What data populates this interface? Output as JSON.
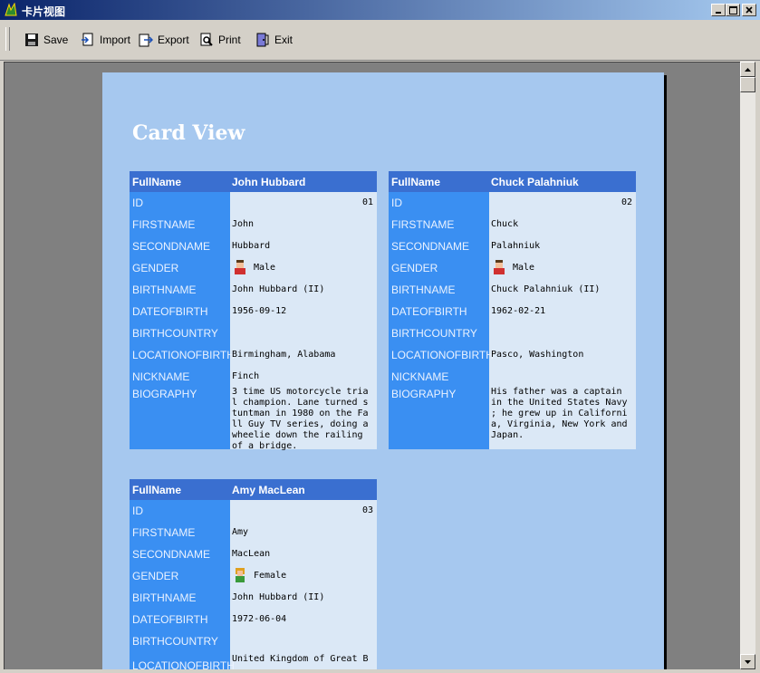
{
  "window": {
    "title": "卡片视图"
  },
  "toolbar": {
    "save": "Save",
    "import": "Import",
    "export": "Export",
    "print": "Print",
    "exit": "Exit"
  },
  "report": {
    "title": "Card View",
    "header_label": "FullName",
    "labels": {
      "id": "ID",
      "firstname": "FIRSTNAME",
      "secondname": "SECONDNAME",
      "gender": "GENDER",
      "birthname": "BIRTHNAME",
      "dateofbirth": "DATEOFBIRTH",
      "birthcountry": "BIRTHCOUNTRY",
      "locationofbirth": "LOCATIONOFBIRTH",
      "nickname": "NICKNAME",
      "biography": "BIOGRAPHY"
    },
    "cards": [
      {
        "fullname": "John Hubbard",
        "id": "01",
        "firstname": "John",
        "secondname": "Hubbard",
        "gender": "Male",
        "birthname": "John Hubbard (II)",
        "dateofbirth": "1956-09-12",
        "birthcountry": "",
        "locationofbirth": "Birmingham, Alabama",
        "nickname": "Finch",
        "biography": "3 time US motorcycle tria\nl champion. Lane turned s\ntuntman in 1980 on the Fa\nll Guy TV series, doing a\n wheelie down the railing\n of a bridge."
      },
      {
        "fullname": "Chuck Palahniuk",
        "id": "02",
        "firstname": "Chuck",
        "secondname": "Palahniuk",
        "gender": "Male",
        "birthname": "Chuck Palahniuk (II)",
        "dateofbirth": "1962-02-21",
        "birthcountry": "",
        "locationofbirth": "Pasco, Washington",
        "nickname": "",
        "biography": "His father was a captain\nin the United States Navy\n; he grew up in Californi\na, Virginia, New York and\n Japan."
      },
      {
        "fullname": "Amy MacLean",
        "id": "03",
        "firstname": "Amy",
        "secondname": "MacLean",
        "gender": "Female",
        "birthname": "John Hubbard (II)",
        "dateofbirth": "1972-06-04",
        "birthcountry": "",
        "locationofbirth": "United Kingdom of Great B"
      }
    ]
  }
}
